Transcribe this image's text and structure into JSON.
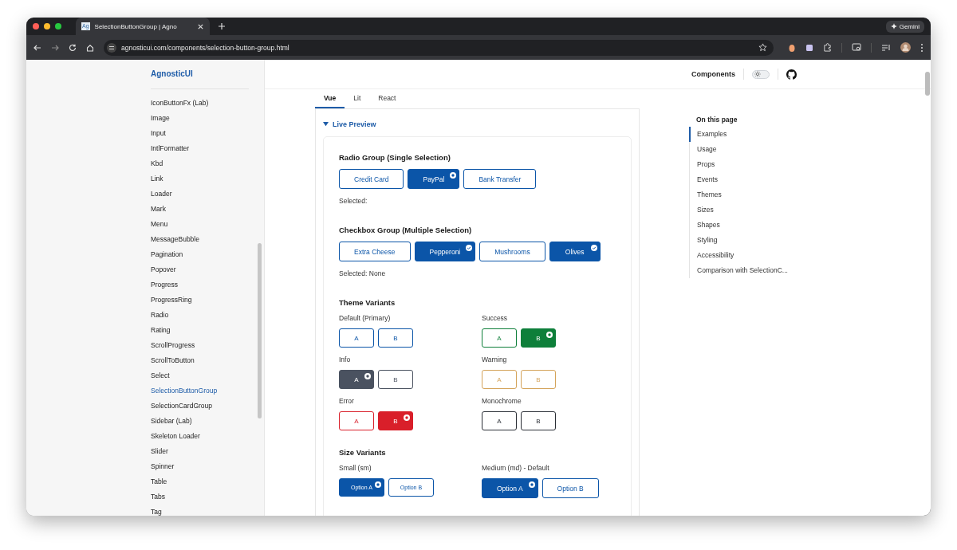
{
  "browser": {
    "favicon_text": "Ag",
    "tab_title": "SelectionButtonGroup | Agno",
    "url": "agnosticui.com/components/selection-button-group.html",
    "gemini_label": "Gemini"
  },
  "sidebar": {
    "title": "AgnosticUI",
    "items": [
      {
        "label": "IconButtonFx (Lab)",
        "selected": false
      },
      {
        "label": "Image",
        "selected": false
      },
      {
        "label": "Input",
        "selected": false
      },
      {
        "label": "IntlFormatter",
        "selected": false
      },
      {
        "label": "Kbd",
        "selected": false
      },
      {
        "label": "Link",
        "selected": false
      },
      {
        "label": "Loader",
        "selected": false
      },
      {
        "label": "Mark",
        "selected": false
      },
      {
        "label": "Menu",
        "selected": false
      },
      {
        "label": "MessageBubble",
        "selected": false
      },
      {
        "label": "Pagination",
        "selected": false
      },
      {
        "label": "Popover",
        "selected": false
      },
      {
        "label": "Progress",
        "selected": false
      },
      {
        "label": "ProgressRing",
        "selected": false
      },
      {
        "label": "Radio",
        "selected": false
      },
      {
        "label": "Rating",
        "selected": false
      },
      {
        "label": "ScrollProgress",
        "selected": false
      },
      {
        "label": "ScrollToButton",
        "selected": false
      },
      {
        "label": "Select",
        "selected": false
      },
      {
        "label": "SelectionButtonGroup",
        "selected": true
      },
      {
        "label": "SelectionCardGroup",
        "selected": false
      },
      {
        "label": "Sidebar (Lab)",
        "selected": false
      },
      {
        "label": "Skeleton Loader",
        "selected": false
      },
      {
        "label": "Slider",
        "selected": false
      },
      {
        "label": "Spinner",
        "selected": false
      },
      {
        "label": "Table",
        "selected": false
      },
      {
        "label": "Tabs",
        "selected": false
      },
      {
        "label": "Tag",
        "selected": false
      }
    ]
  },
  "header": {
    "nav_link": "Components",
    "theme_toggle": {
      "on": false
    }
  },
  "framework_tabs": [
    {
      "label": "Vue",
      "selected": true
    },
    {
      "label": "Lit",
      "selected": false
    },
    {
      "label": "React",
      "selected": false
    }
  ],
  "preview": {
    "toggle_label": "Live Preview",
    "expanded": true,
    "sections": [
      {
        "kind": "radio",
        "title": "Radio Group (Single Selection)",
        "status": "Selected:",
        "options": [
          {
            "label": "Credit Card",
            "selected": false
          },
          {
            "label": "PayPal",
            "selected": true
          },
          {
            "label": "Bank Transfer",
            "selected": false
          }
        ]
      },
      {
        "kind": "checkbox",
        "title": "Checkbox Group (Multiple Selection)",
        "status": "Selected: None",
        "options": [
          {
            "label": "Extra Cheese",
            "selected": false
          },
          {
            "label": "Pepperoni",
            "selected": true
          },
          {
            "label": "Mushrooms",
            "selected": false
          },
          {
            "label": "Olives",
            "selected": true
          }
        ]
      },
      {
        "kind": "variants",
        "title": "Theme Variants",
        "groups": [
          {
            "label": "Default (Primary)",
            "color": "#0b55a8",
            "kind": "regular",
            "options": [
              {
                "label": "A",
                "selected": false
              },
              {
                "label": "B",
                "selected": false
              }
            ]
          },
          {
            "label": "Success",
            "color": "#0e7f3a",
            "kind": "regular",
            "options": [
              {
                "label": "A",
                "selected": false
              },
              {
                "label": "B",
                "selected": true
              }
            ]
          },
          {
            "label": "Info",
            "color": "#4a5260",
            "kind": "regular",
            "options": [
              {
                "label": "A",
                "selected": true
              },
              {
                "label": "B",
                "selected": false
              }
            ]
          },
          {
            "label": "Warning",
            "color": "#d4a35a",
            "kind": "regular",
            "options": [
              {
                "label": "A",
                "selected": false
              },
              {
                "label": "B",
                "selected": false
              }
            ]
          },
          {
            "label": "Error",
            "color": "#d91f2a",
            "kind": "regular",
            "options": [
              {
                "label": "A",
                "selected": false
              },
              {
                "label": "B",
                "selected": true
              }
            ]
          },
          {
            "label": "Monochrome",
            "color": "#2b2f36",
            "kind": "regular",
            "options": [
              {
                "label": "A",
                "selected": false
              },
              {
                "label": "B",
                "selected": false
              }
            ]
          }
        ]
      },
      {
        "kind": "variants",
        "title": "Size Variants",
        "groups": [
          {
            "label": "Small (sm)",
            "color": "#0b55a8",
            "kind": "small",
            "options": [
              {
                "label": "Option A",
                "selected": true
              },
              {
                "label": "Option B",
                "selected": false
              }
            ]
          },
          {
            "label": "Medium (md) - Default",
            "color": "#0b55a8",
            "kind": "medium",
            "options": [
              {
                "label": "Option A",
                "selected": true
              },
              {
                "label": "Option B",
                "selected": false
              }
            ]
          }
        ]
      }
    ]
  },
  "toc": {
    "title": "On this page",
    "items": [
      {
        "label": "Examples",
        "selected": true
      },
      {
        "label": "Usage",
        "selected": false
      },
      {
        "label": "Props",
        "selected": false
      },
      {
        "label": "Events",
        "selected": false
      },
      {
        "label": "Themes",
        "selected": false
      },
      {
        "label": "Sizes",
        "selected": false
      },
      {
        "label": "Shapes",
        "selected": false
      },
      {
        "label": "Styling",
        "selected": false
      },
      {
        "label": "Accessibility",
        "selected": false
      },
      {
        "label": "Comparison with SelectionC...",
        "selected": false
      }
    ]
  }
}
